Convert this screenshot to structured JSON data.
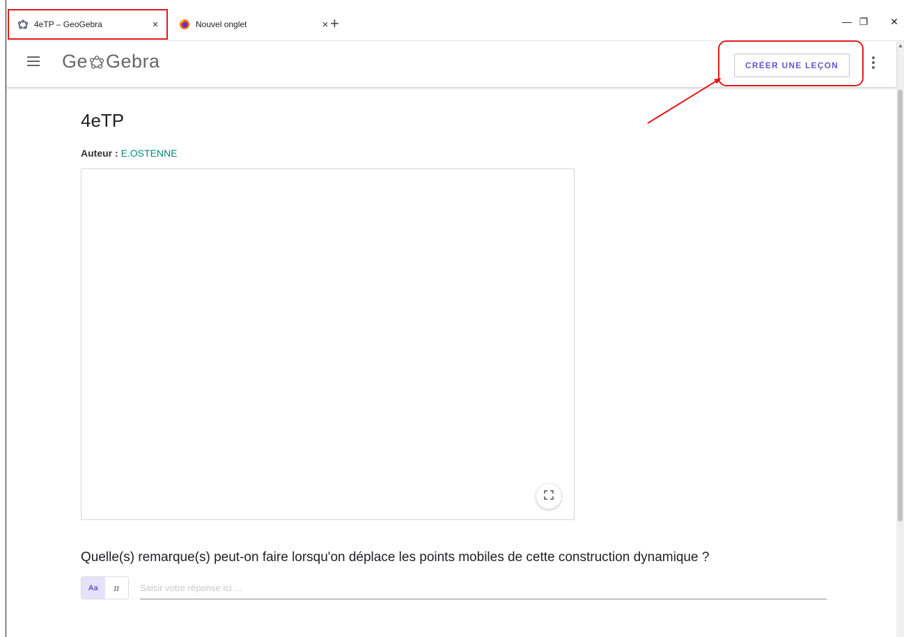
{
  "browser": {
    "tabs": [
      {
        "label": "4eTP – GeoGebra",
        "icon": "geogebra-icon",
        "active": true
      },
      {
        "label": "Nouvel onglet",
        "icon": "firefox-icon",
        "active": false
      }
    ],
    "close_glyph": "×",
    "new_tab_glyph": "+",
    "window_controls": {
      "minimize": "—",
      "restore": "❐",
      "close": "✕"
    }
  },
  "header": {
    "logo_left": "Ge",
    "logo_right": "Gebra",
    "create_lesson_label": "CRÉER UNE LEÇON",
    "accent_color": "#6557d2"
  },
  "content": {
    "title": "4eTP",
    "author_label": "Auteur :",
    "author_name": "E.OSTENNE",
    "question": "Quelle(s) remarque(s) peut-on faire lorsqu'on déplace les points mobiles de cette construction dynamique ?",
    "mode_text": "Aa",
    "mode_math": "π",
    "answer_placeholder": "Saisir votre réponse ici ...",
    "author_color": "#00897b"
  },
  "annotation": {
    "highlight_color": "#e01818"
  }
}
